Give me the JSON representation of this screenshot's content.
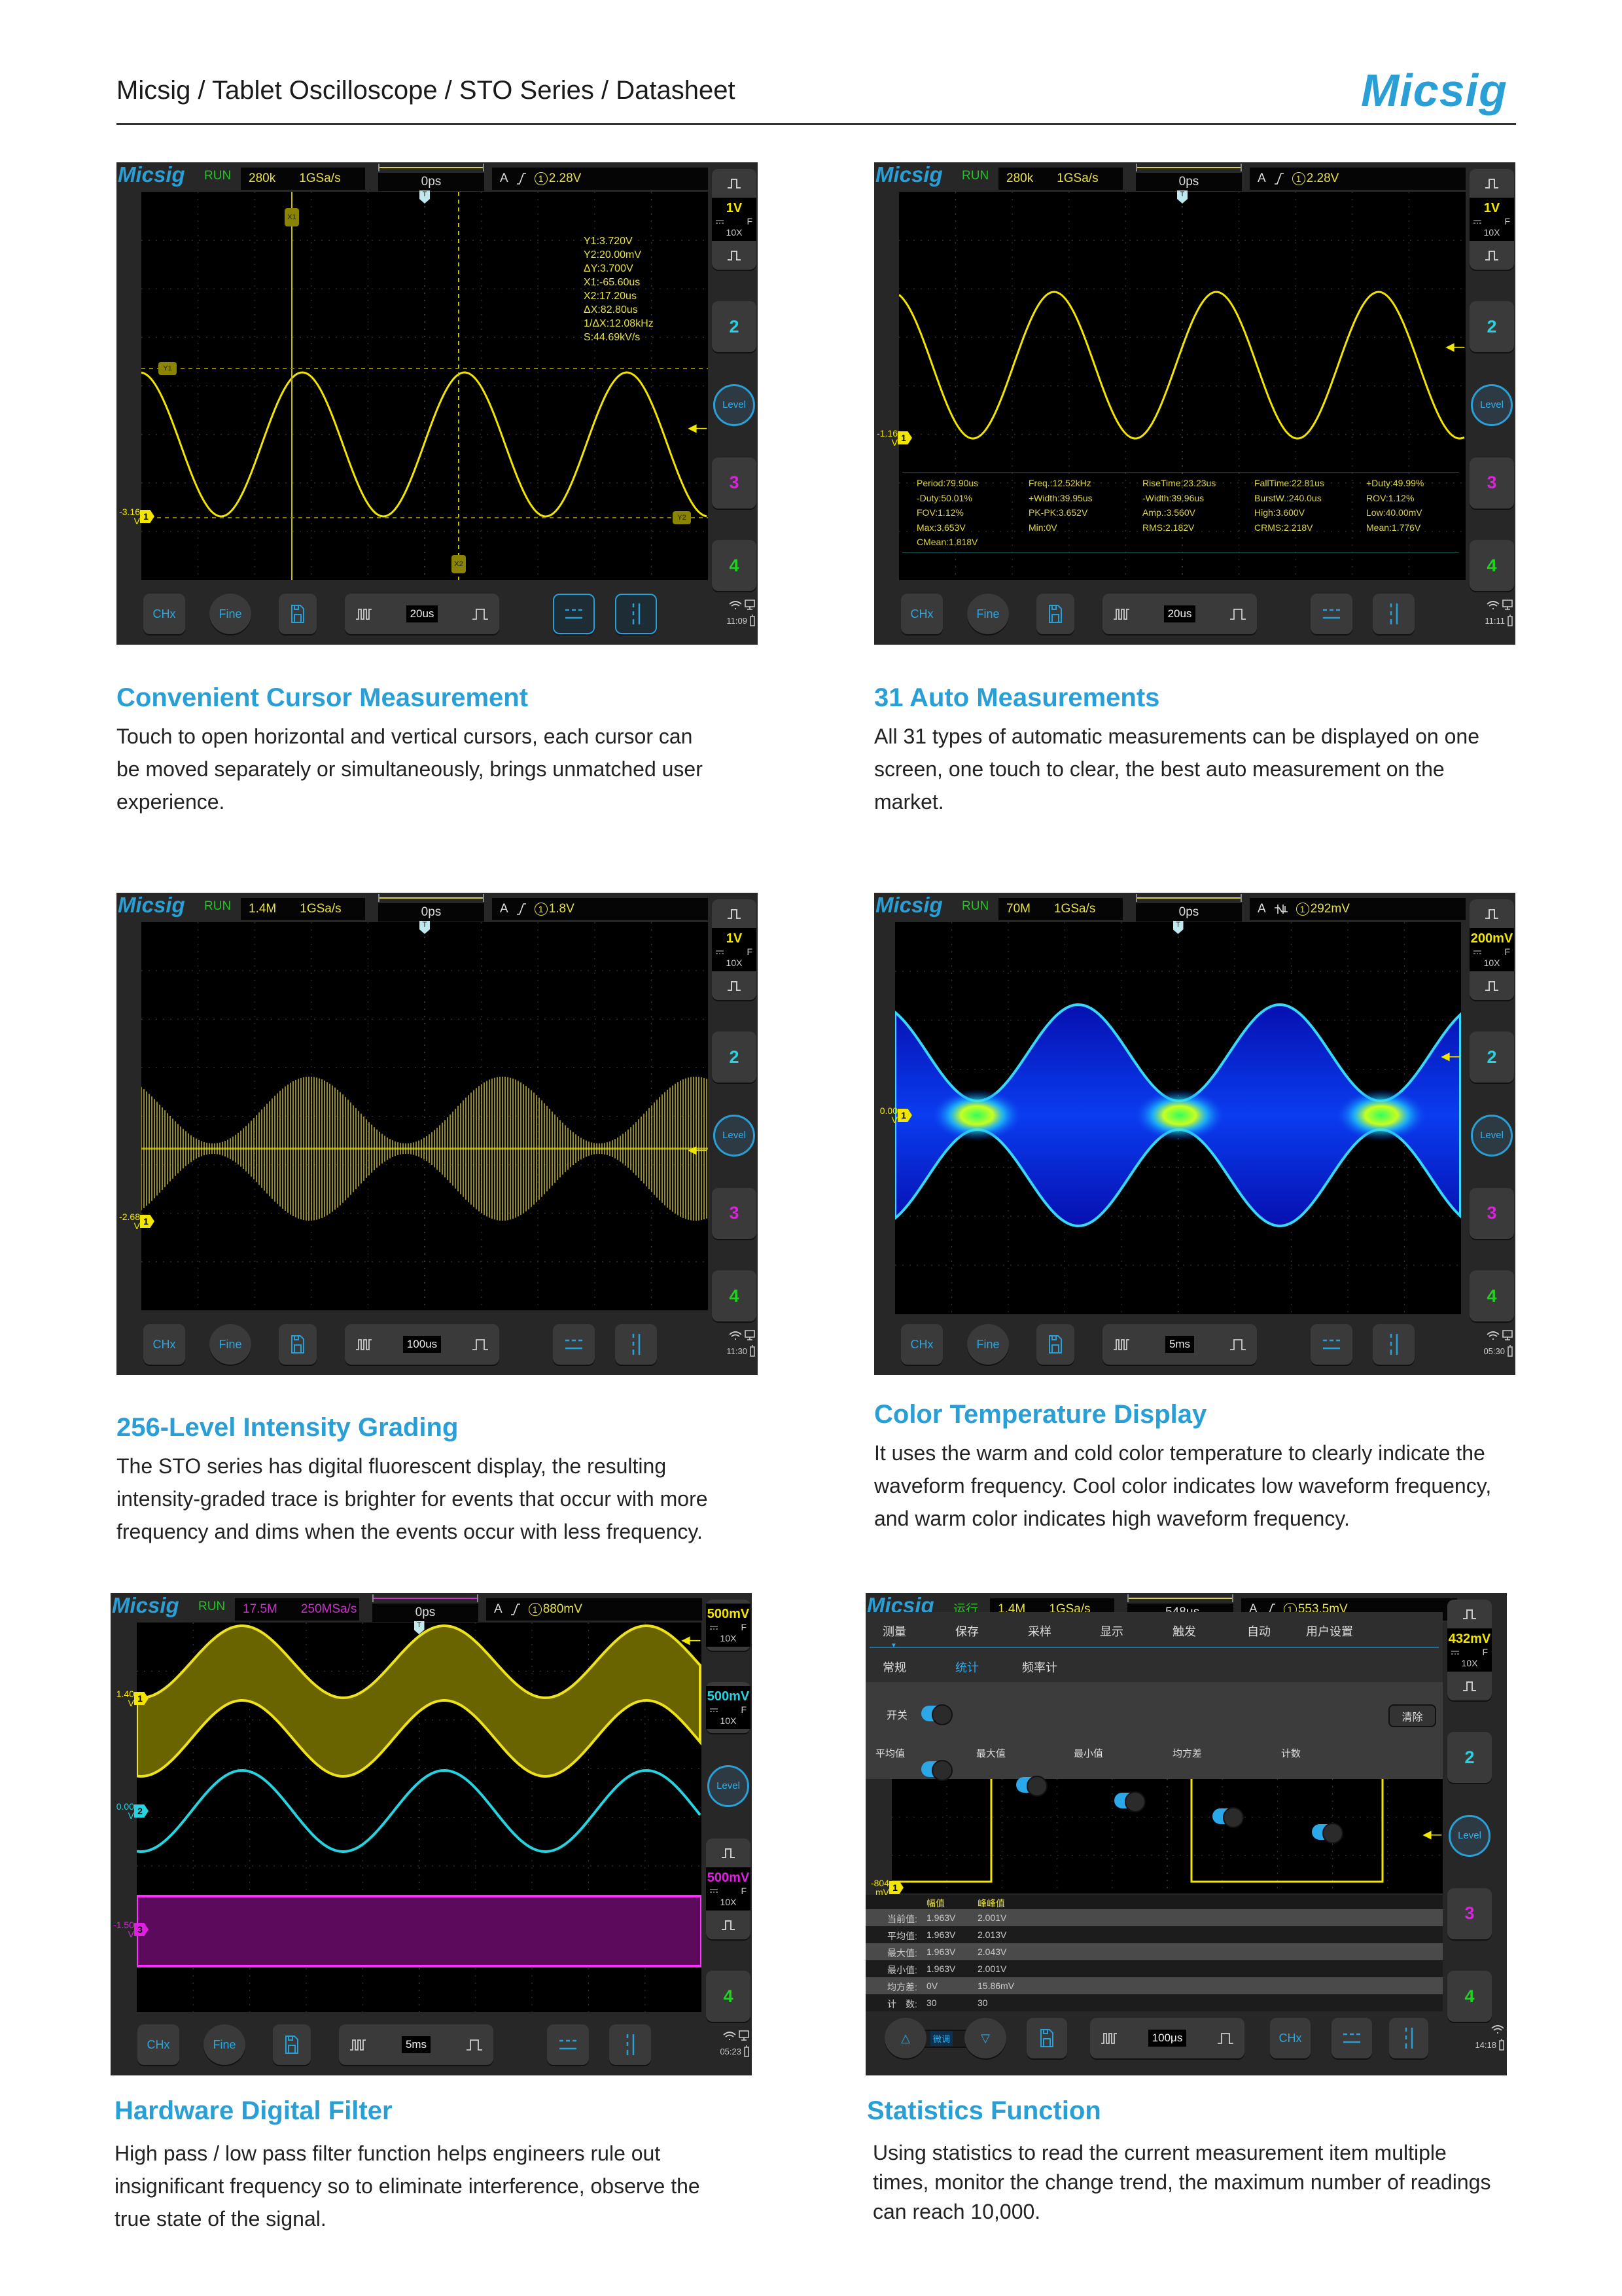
{
  "header": {
    "breadcrumb": "Micsig / Tablet Oscilloscope / STO Series / Datasheet",
    "logo": "Micsig"
  },
  "colors": {
    "accent": "#2a9fd6",
    "ch1": "#f2e600",
    "ch2": "#27d3e0",
    "ch3": "#e020e0",
    "ch4": "#22d022",
    "run": "#22c422",
    "acq": "#e6e04a"
  },
  "sections": [
    {
      "title": "Convenient Cursor Measurement",
      "lines": [
        "Touch to open horizontal and vertical cursors, each cursor can",
        "be moved separately or simultaneously, brings unmatched user",
        "experience."
      ]
    },
    {
      "title": "31 Auto Measurements",
      "lines": [
        "All 31 types of automatic measurements can be displayed on one",
        "screen, one touch to clear, the best auto measurement on the",
        "market."
      ]
    },
    {
      "title": "256-Level Intensity Grading",
      "lines": [
        "The STO series has digital fluorescent display, the resulting",
        "intensity-graded trace is brighter for events that occur with more",
        "frequency and dims when the events occur with less frequency."
      ]
    },
    {
      "title": "Color Temperature Display",
      "lines": [
        "It uses the warm and cold color temperature to clearly indicate the",
        "waveform frequency. Cool color indicates low waveform frequency,",
        "and warm color indicates high waveform frequency."
      ]
    },
    {
      "title": "Hardware Digital Filter",
      "lines": [
        "High pass / low pass filter function helps engineers rule out",
        "insignificant frequency so to eliminate interference, observe the",
        "true state of the signal."
      ]
    },
    {
      "title": "Statistics Function",
      "lines": [
        "Using statistics to read the current measurement item multiple",
        "times, monitor the change trend, the maximum number of readings",
        "can reach 10,000."
      ]
    }
  ],
  "scopes": [
    {
      "logo": "Micsig",
      "status": "RUN",
      "memory": "280k",
      "sample_rate": "1GSa/s",
      "acq_color": "#e6e04a",
      "time_offset": "0ps",
      "trigger_source": "A",
      "trigger_icon": "rising-edge-icon",
      "trigger_channel": "1",
      "trigger_level": "2.28V",
      "right": [
        {
          "kind": "group",
          "scale": {
            "value": "1V",
            "coupling": "F",
            "probe": "10X",
            "color": "#f2e600"
          }
        },
        {
          "kind": "ch",
          "label": "2",
          "color": "#27d3e0"
        },
        {
          "kind": "level",
          "label": "Level"
        },
        {
          "kind": "ch",
          "label": "3",
          "color": "#e020e0"
        },
        {
          "kind": "ch",
          "label": "4",
          "color": "#22d022"
        }
      ],
      "bottom": {
        "items": [
          {
            "kind": "chx",
            "label": "CHx"
          },
          {
            "kind": "fine",
            "label": "Fine"
          },
          {
            "kind": "save"
          },
          {
            "kind": "timebase",
            "value": "20us"
          },
          {
            "kind": "hcursor",
            "active": true
          },
          {
            "kind": "vcursor",
            "active": true
          }
        ],
        "clock": "11:09"
      },
      "markers": [
        {
          "value": "-3.16",
          "unit": "V",
          "channel": "1",
          "color": "#f2e600"
        }
      ],
      "cursor_labels": [
        "X1",
        "X2",
        "Y1",
        "Y2"
      ],
      "cursor_readouts": [
        "Y1:3.720V",
        "Y2:20.00mV",
        "ΔY:3.700V",
        "X1:-65.60us",
        "X2:17.20us",
        "ΔX:82.80us",
        "1/ΔX:12.08kHz",
        "S:44.69kV/s"
      ]
    },
    {
      "logo": "Micsig",
      "status": "RUN",
      "memory": "280k",
      "sample_rate": "1GSa/s",
      "acq_color": "#e6e04a",
      "time_offset": "0ps",
      "trigger_source": "A",
      "trigger_icon": "rising-edge-icon",
      "trigger_channel": "1",
      "trigger_level": "2.28V",
      "right": [
        {
          "kind": "group",
          "scale": {
            "value": "1V",
            "coupling": "F",
            "probe": "10X",
            "color": "#f2e600"
          }
        },
        {
          "kind": "ch",
          "label": "2",
          "color": "#27d3e0"
        },
        {
          "kind": "level",
          "label": "Level"
        },
        {
          "kind": "ch",
          "label": "3",
          "color": "#e020e0"
        },
        {
          "kind": "ch",
          "label": "4",
          "color": "#22d022"
        }
      ],
      "bottom": {
        "items": [
          {
            "kind": "chx",
            "label": "CHx"
          },
          {
            "kind": "fine",
            "label": "Fine"
          },
          {
            "kind": "save"
          },
          {
            "kind": "timebase",
            "value": "20us"
          },
          {
            "kind": "hcursor"
          },
          {
            "kind": "vcursor"
          }
        ],
        "clock": "11:11"
      },
      "markers": [
        {
          "value": "-1.16",
          "unit": "V",
          "channel": "1",
          "color": "#f2e600"
        }
      ],
      "measurements": [
        "Period:79.90us",
        "Freq.:12.52kHz",
        "RiseTime:23.23us",
        "FallTime:22.81us",
        "+Duty:49.99%",
        "-Duty:50.01%",
        "+Width:39.95us",
        "-Width:39.96us",
        "BurstW.:240.0us",
        "ROV:1.12%",
        "FOV:1.12%",
        "PK-PK:3.652V",
        "Amp.:3.560V",
        "High:3.600V",
        "Low:40.00mV",
        "Max:3.653V",
        "Min:0V",
        "RMS:2.182V",
        "CRMS:2.218V",
        "Mean:1.776V",
        "CMean:1.818V"
      ]
    },
    {
      "logo": "Micsig",
      "status": "RUN",
      "memory": "1.4M",
      "sample_rate": "1GSa/s",
      "acq_color": "#e6e04a",
      "time_offset": "0ps",
      "trigger_source": "A",
      "trigger_icon": "rising-edge-icon",
      "trigger_channel": "1",
      "trigger_level": "1.8V",
      "right": [
        {
          "kind": "group",
          "scale": {
            "value": "1V",
            "coupling": "F",
            "probe": "10X",
            "color": "#f2e600"
          }
        },
        {
          "kind": "ch",
          "label": "2",
          "color": "#27d3e0"
        },
        {
          "kind": "level",
          "label": "Level"
        },
        {
          "kind": "ch",
          "label": "3",
          "color": "#e020e0"
        },
        {
          "kind": "ch",
          "label": "4",
          "color": "#22d022"
        }
      ],
      "bottom": {
        "items": [
          {
            "kind": "chx",
            "label": "CHx"
          },
          {
            "kind": "fine",
            "label": "Fine"
          },
          {
            "kind": "save"
          },
          {
            "kind": "timebase",
            "value": "100us"
          },
          {
            "kind": "hcursor"
          },
          {
            "kind": "vcursor"
          }
        ],
        "clock": "11:30"
      },
      "markers": [
        {
          "value": "-2.68",
          "unit": "V",
          "channel": "1",
          "color": "#f2e600"
        }
      ]
    },
    {
      "logo": "Micsig",
      "status": "RUN",
      "memory": "70M",
      "sample_rate": "1GSa/s",
      "acq_color": "#e6e04a",
      "time_offset": "0ps",
      "trigger_source": "A",
      "trigger_icon": "noise-reject-trigger-icon",
      "trigger_channel": "1",
      "trigger_level": "292mV",
      "right": [
        {
          "kind": "group",
          "scale": {
            "value": "200mV",
            "coupling": "F",
            "probe": "10X",
            "color": "#f2e600"
          }
        },
        {
          "kind": "ch",
          "label": "2",
          "color": "#27d3e0"
        },
        {
          "kind": "level",
          "label": "Level"
        },
        {
          "kind": "ch",
          "label": "3",
          "color": "#e020e0"
        },
        {
          "kind": "ch",
          "label": "4",
          "color": "#22d022"
        }
      ],
      "bottom": {
        "items": [
          {
            "kind": "chx",
            "label": "CHx"
          },
          {
            "kind": "fine",
            "label": "Fine"
          },
          {
            "kind": "save"
          },
          {
            "kind": "timebase",
            "value": "5ms"
          },
          {
            "kind": "hcursor"
          },
          {
            "kind": "vcursor"
          }
        ],
        "clock": "05:30"
      },
      "markers": [
        {
          "value": "0.00",
          "unit": "V",
          "channel": "1",
          "color": "#f2e600"
        }
      ]
    },
    {
      "logo": "Micsig",
      "status": "RUN",
      "memory": "17.5M",
      "sample_rate": "250MSa/s",
      "acq_color": "#c832c8",
      "time_offset": "0ps",
      "trigger_source": "A",
      "trigger_icon": "rising-edge-icon",
      "trigger_channel": "1",
      "trigger_level": "880mV",
      "right": [
        {
          "kind": "scale",
          "scale": {
            "value": "500mV",
            "coupling": "F",
            "probe": "10X",
            "color": "#f2e600"
          }
        },
        {
          "kind": "scale",
          "scale": {
            "value": "500mV",
            "coupling": "F",
            "probe": "10X",
            "color": "#27d3e0"
          }
        },
        {
          "kind": "level",
          "label": "Level"
        },
        {
          "kind": "group",
          "scale": {
            "value": "500mV",
            "coupling": "F",
            "probe": "10X",
            "color": "#e020e0"
          }
        },
        {
          "kind": "ch",
          "label": "4",
          "color": "#22d022"
        }
      ],
      "bottom": {
        "items": [
          {
            "kind": "chx",
            "label": "CHx"
          },
          {
            "kind": "fine",
            "label": "Fine"
          },
          {
            "kind": "save"
          },
          {
            "kind": "timebase",
            "value": "5ms"
          },
          {
            "kind": "hcursor"
          },
          {
            "kind": "vcursor"
          }
        ],
        "clock": "05:23"
      },
      "markers": [
        {
          "value": "1.40",
          "unit": "V",
          "channel": "1",
          "color": "#f2e600"
        },
        {
          "value": "0.00",
          "unit": "V",
          "channel": "2",
          "color": "#27d3e0"
        },
        {
          "value": "-1.50",
          "unit": "V",
          "channel": "3",
          "color": "#e020e0"
        }
      ]
    },
    {
      "logo": "Micsig",
      "status": "运行",
      "memory": "1.4M",
      "sample_rate": "1GSa/s",
      "acq_color": "#e6e04a",
      "time_offset": "-548μs",
      "trigger_source": "A",
      "trigger_icon": "rising-edge-icon",
      "trigger_channel": "1",
      "trigger_level": "553.5mV",
      "right": [
        {
          "kind": "group",
          "scale": {
            "value": "432mV",
            "coupling": "F",
            "probe": "10X",
            "color": "#f2e600"
          }
        },
        {
          "kind": "ch",
          "label": "2",
          "color": "#27d3e0"
        },
        {
          "kind": "level",
          "label": "Level"
        },
        {
          "kind": "ch",
          "label": "3",
          "color": "#e020e0"
        },
        {
          "kind": "ch",
          "label": "4",
          "color": "#22d022"
        }
      ],
      "bottom": {
        "items": [
          {
            "kind": "updown",
            "label": "微调"
          },
          {
            "kind": "save"
          },
          {
            "kind": "timebase",
            "value": "100μs"
          },
          {
            "kind": "chx",
            "label": "CHx"
          },
          {
            "kind": "hcursor"
          },
          {
            "kind": "vcursor"
          }
        ],
        "clock": "14:18"
      },
      "markers": [
        {
          "value": "-804",
          "unit": "mV",
          "channel": "1",
          "color": "#f2e600"
        }
      ],
      "menu": {
        "tabs": [
          "测量",
          "保存",
          "采样",
          "显示",
          "触发",
          "自动",
          "用户设置"
        ],
        "active_tab": 0,
        "subtabs": [
          "常规",
          "统计",
          "频率计"
        ],
        "active_subtab": 1,
        "switch_label": "开关",
        "switch_on": true,
        "clear_label": "清除",
        "toggles": [
          {
            "label": "平均值",
            "on": true
          },
          {
            "label": "最大值",
            "on": true
          },
          {
            "label": "最小值",
            "on": true
          },
          {
            "label": "均方差",
            "on": true
          },
          {
            "label": "计数",
            "on": true
          }
        ]
      },
      "stats": {
        "columns": [
          "幅值",
          "峰峰值"
        ],
        "rows": [
          {
            "label": "当前值:",
            "values": [
              "1.963V",
              "2.001V"
            ]
          },
          {
            "label": "平均值:",
            "values": [
              "1.963V",
              "2.013V"
            ]
          },
          {
            "label": "最大值:",
            "values": [
              "1.963V",
              "2.043V"
            ]
          },
          {
            "label": "最小值:",
            "values": [
              "1.963V",
              "2.001V"
            ]
          },
          {
            "label": "均方差:",
            "values": [
              "0V",
              "15.86mV"
            ]
          },
          {
            "label": "计　数:",
            "values": [
              "30",
              "30"
            ]
          }
        ]
      }
    }
  ]
}
